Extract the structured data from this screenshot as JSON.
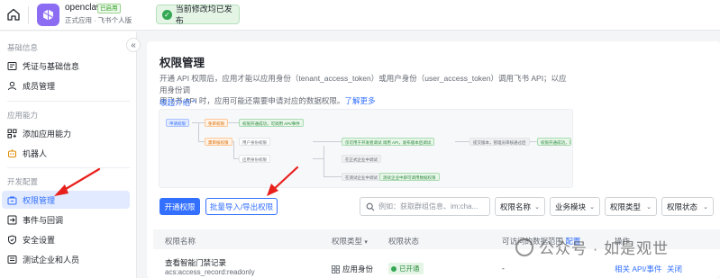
{
  "topbar": {
    "app_name": "openclaw",
    "app_badge": "已启用",
    "app_sub": "正式应用 · 飞书个人版",
    "toast": "当前修改均已发布"
  },
  "sidebar": {
    "sections": [
      {
        "title": "基础信息",
        "items": [
          {
            "label": "凭证与基础信息"
          },
          {
            "label": "成员管理"
          }
        ]
      },
      {
        "title": "应用能力",
        "items": [
          {
            "label": "添加应用能力"
          },
          {
            "label": "机器人"
          }
        ]
      },
      {
        "title": "开发配置",
        "items": [
          {
            "label": "权限管理"
          },
          {
            "label": "事件与回调"
          },
          {
            "label": "安全设置"
          },
          {
            "label": "测试企业和人员"
          }
        ]
      }
    ]
  },
  "main": {
    "title": "权限管理",
    "desc1": "开通 API 权限后，应用才能以应用身份（tenant_access_token）或用户身份（user_access_token）调用飞书 API；以应用身份调",
    "desc2": "用飞书 API 时，应用可能还需要申请对应的数据权限。",
    "desc_link": "了解更多",
    "fold": "收起介绍 ^",
    "flow": {
      "n1": "申请权限",
      "n2": "免审权限",
      "n3": "权限开通成功，可调用 API/事件",
      "n4": "需审核权限",
      "n5": "用户身份权限",
      "n6": "应用身份权限",
      "n7": "仅可用于开发者调试 调用 API，发布版本后调试",
      "n8": "提交版本，管理员审核通过后",
      "n9": "权限开通成功，可调用 API/事件",
      "n10": "在正式企业中调试",
      "n11": "在测试企业中调试",
      "n12": "测试企业中即可调用数据权限"
    },
    "btn_open": "开通权限",
    "btn_batch": "批量导入/导出权限",
    "search_placeholder": "例如：获取群组信息、im:cha...",
    "filters": [
      "权限名称",
      "业务模块",
      "权限类型",
      "权限状态"
    ],
    "table": {
      "headers": {
        "name": "权限名称",
        "type": "权限类型",
        "status": "权限状态",
        "scope": "可访问的数据范围",
        "scope_link": "配置",
        "ops": "操作"
      },
      "rows": [
        {
          "name": "查看智能门禁记录",
          "code": "acs:access_record:readonly",
          "type": "应用身份",
          "status": "已开通",
          "scope": "-",
          "op1": "相关 API/事件",
          "op2": "关闭"
        }
      ]
    }
  },
  "watermark": "公众号 · 如是观世",
  "colors": {
    "primary": "#3370ff",
    "success": "#34a853",
    "annotation": "#e8201c"
  }
}
